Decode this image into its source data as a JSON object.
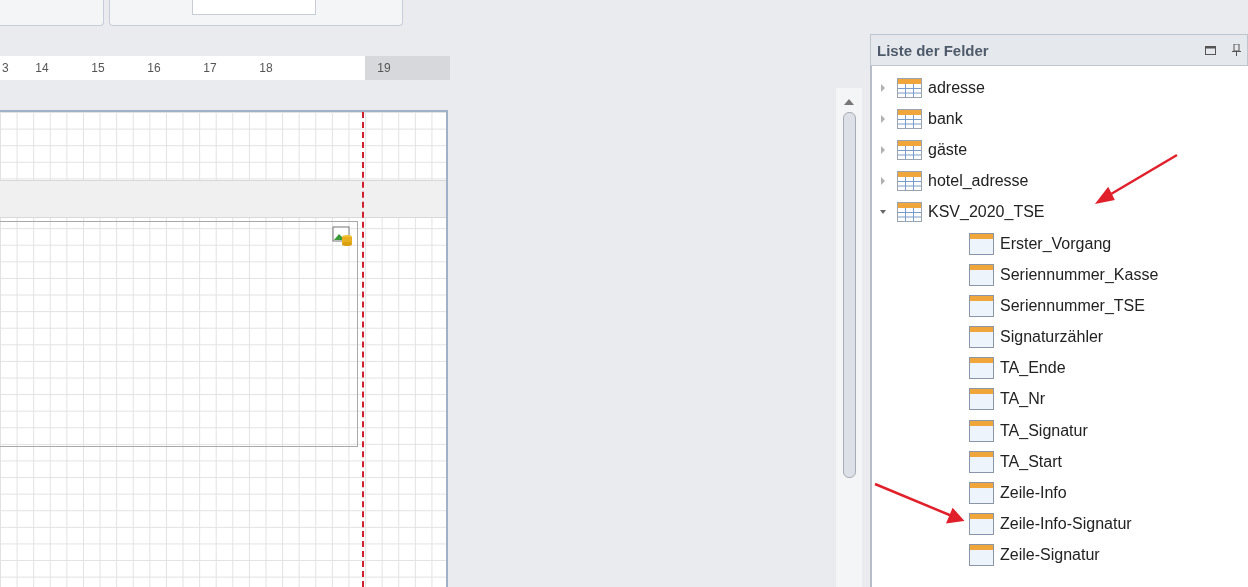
{
  "ruler": {
    "labels": [
      "3",
      "14",
      "15",
      "16",
      "17",
      "18",
      "19"
    ]
  },
  "field_list": {
    "title": "Liste der Felder",
    "tables": [
      {
        "name": "adresse",
        "expanded": false
      },
      {
        "name": "bank",
        "expanded": false
      },
      {
        "name": "gäste",
        "expanded": false
      },
      {
        "name": "hotel_adresse",
        "expanded": false
      },
      {
        "name": "KSV_2020_TSE",
        "expanded": true,
        "children": [
          {
            "name": "Erster_Vorgang"
          },
          {
            "name": "Seriennummer_Kasse"
          },
          {
            "name": "Seriennummer_TSE"
          },
          {
            "name": "Signaturzähler"
          },
          {
            "name": "TA_Ende"
          },
          {
            "name": "TA_Nr"
          },
          {
            "name": "TA_Signatur"
          },
          {
            "name": "TA_Start"
          },
          {
            "name": "Zeile-Info"
          },
          {
            "name": "Zeile-Info-Signatur"
          },
          {
            "name": "Zeile-Signatur"
          }
        ]
      }
    ]
  }
}
